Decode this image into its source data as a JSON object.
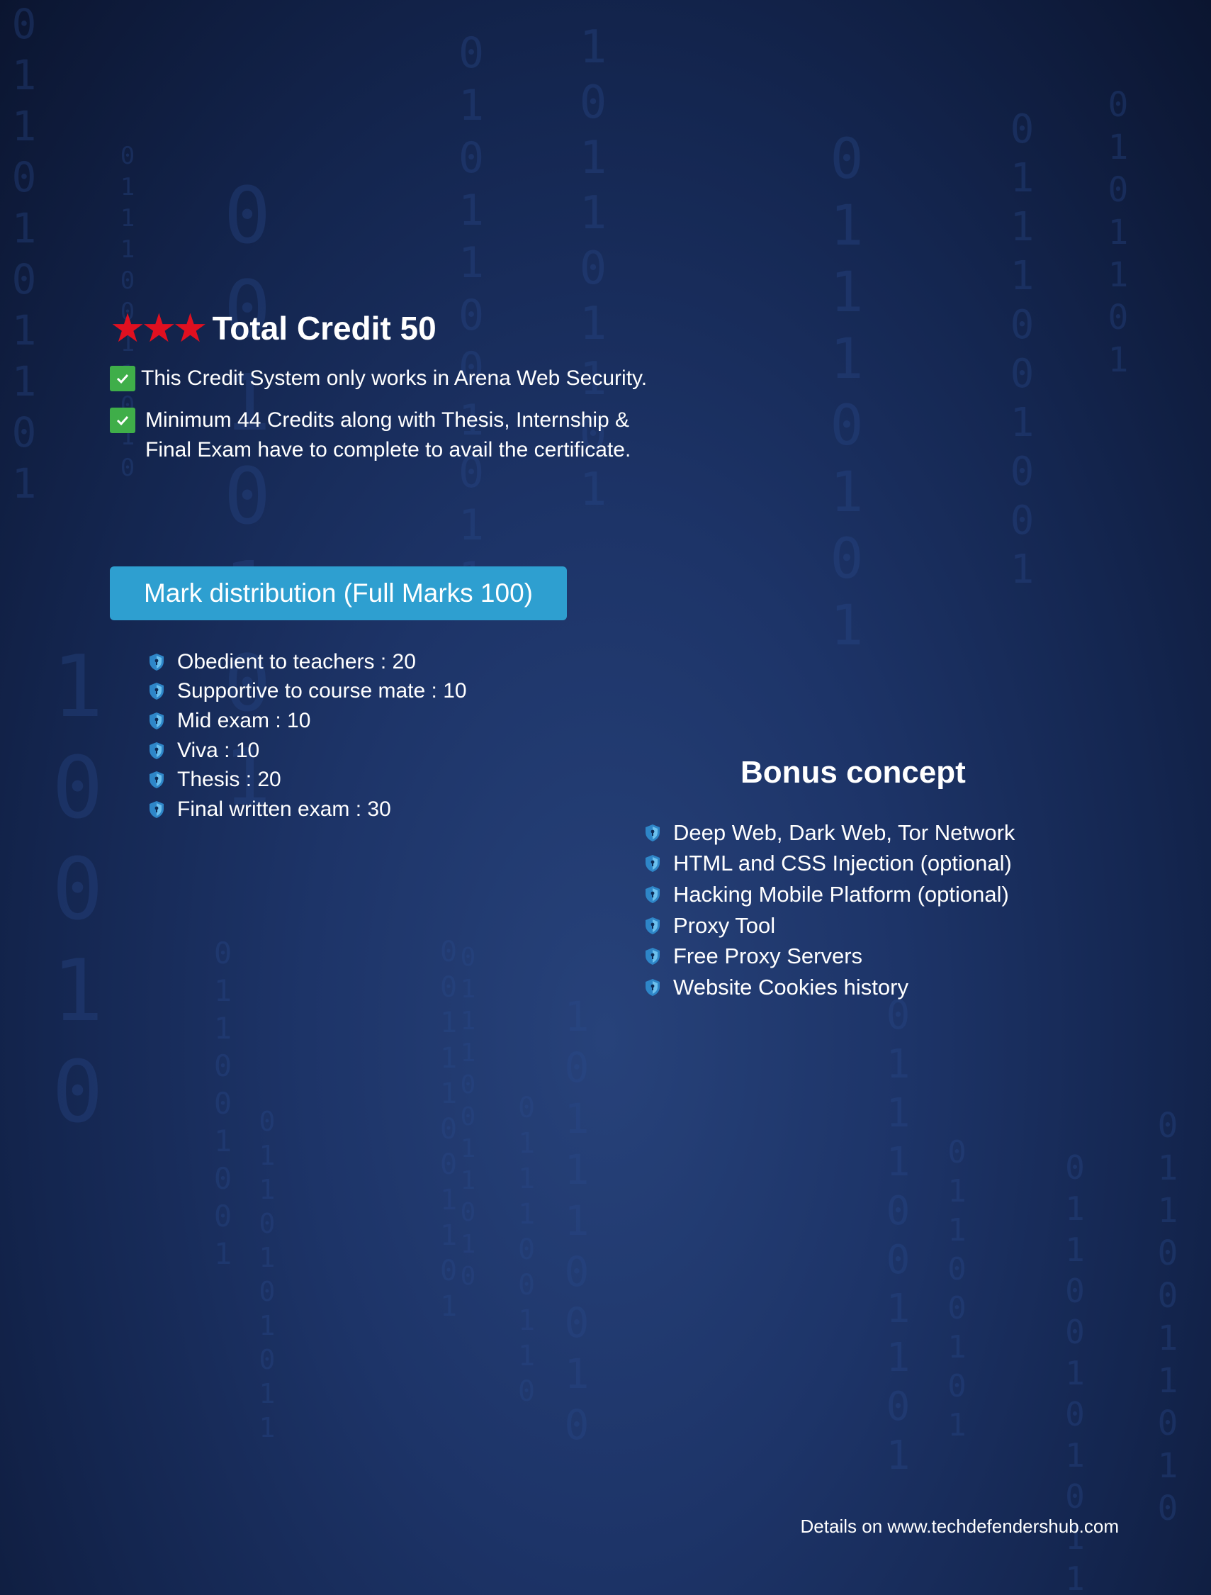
{
  "header": {
    "title": "Total Credit 50",
    "star_color": "#e01020",
    "star_icon": "star-icon",
    "star_count": 3
  },
  "notes": [
    {
      "icon": "check-icon",
      "text": "This Credit System only works in Arena Web Security."
    },
    {
      "icon": "check-icon",
      "line1": "Minimum 44 Credits along with Thesis, Internship &",
      "line2": "Final Exam have to complete to avail the certificate."
    }
  ],
  "mark_distribution": {
    "title": "Mark distribution (Full Marks 100)",
    "accent": "#2e9fd0",
    "items": [
      "Obedient to teachers : 20",
      "Supportive to course mate : 10",
      "Mid exam : 10",
      "Viva : 10",
      "Thesis : 20",
      "Final written exam : 30"
    ]
  },
  "bonus": {
    "title": "Bonus concept",
    "items": [
      "Deep Web, Dark Web, Tor Network",
      "HTML and CSS Injection (optional)",
      "Hacking Mobile Platform (optional)",
      "Proxy Tool",
      "Free Proxy Servers",
      "Website Cookies history"
    ]
  },
  "footer": {
    "text": "Details on www.techdefendershub.com"
  },
  "colors": {
    "background": "#142650",
    "check": "#3fae49",
    "shield": "#2e86c8"
  }
}
